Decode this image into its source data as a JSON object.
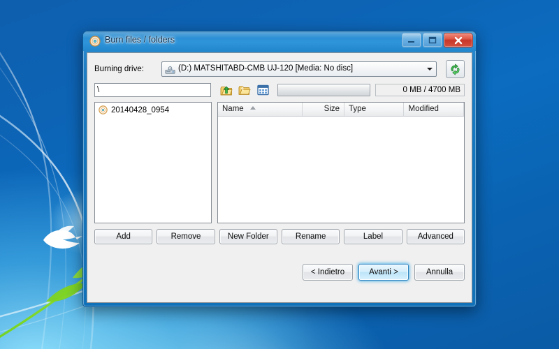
{
  "window": {
    "title": "Burn files / folders",
    "title_icon": "disc-icon",
    "controls": {
      "minimize": "minimize-icon",
      "maximize": "maximize-icon",
      "close": "close-icon",
      "close_glyph": "✕"
    }
  },
  "drive": {
    "label": "Burning drive:",
    "selected": "(D:) MATSHITABD-CMB UJ-120 [Media: No disc]",
    "icon": "optical-drive-icon",
    "refresh_icon": "refresh-icon"
  },
  "toolbar": {
    "path_value": "\\",
    "path_placeholder": "",
    "icons": {
      "up": "folder-up-icon",
      "new_folder": "new-folder-icon",
      "view": "view-details-icon"
    },
    "capacity_used_percent": 0,
    "capacity_text": "0 MB / 4700 MB"
  },
  "tree": {
    "items": [
      {
        "label": "20140428_0954",
        "icon": "disc-icon"
      }
    ]
  },
  "file_list": {
    "columns": [
      {
        "label": "Name",
        "sort": "asc"
      },
      {
        "label": "Size"
      },
      {
        "label": "Type"
      },
      {
        "label": "Modified"
      }
    ],
    "rows": []
  },
  "actions": [
    {
      "label": "Add",
      "name": "add-button"
    },
    {
      "label": "Remove",
      "name": "remove-button"
    },
    {
      "label": "New Folder",
      "name": "new-folder-button"
    },
    {
      "label": "Rename",
      "name": "rename-button"
    },
    {
      "label": "Label",
      "name": "label-button"
    },
    {
      "label": "Advanced",
      "name": "advanced-button"
    }
  ],
  "navigation": {
    "back": "< Indietro",
    "next": "Avanti >",
    "cancel": "Annulla"
  },
  "colors": {
    "titlebar_blue": "#2f95da",
    "frame_blue": "#1275bd",
    "close_red": "#c8372a",
    "dialog_bg": "#f0f0f0",
    "pane_bg": "#ffffff",
    "default_btn_glow": "#3caae6",
    "desktop_blue": "#0b5ca8"
  }
}
